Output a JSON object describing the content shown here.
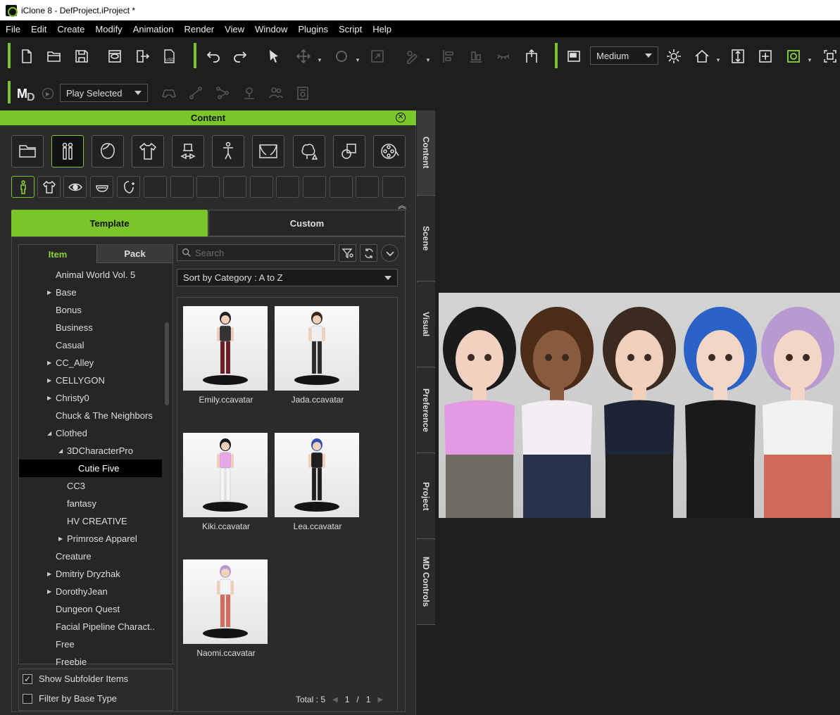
{
  "window": {
    "title": "iClone 8 - DefProject.iProject *"
  },
  "menu": [
    "File",
    "Edit",
    "Create",
    "Modify",
    "Animation",
    "Render",
    "View",
    "Window",
    "Plugins",
    "Script",
    "Help"
  ],
  "toolbar": {
    "quality": "Medium",
    "play_mode": "Play Selected"
  },
  "panel": {
    "title": "Content",
    "tabs": {
      "template": "Template",
      "custom": "Custom"
    },
    "tree_tabs": {
      "item": "Item",
      "pack": "Pack"
    },
    "search_placeholder": "Search",
    "sort": "Sort by Category : A to Z",
    "tree": [
      {
        "label": "Animal World Vol. 5",
        "level": 0,
        "arrow": ""
      },
      {
        "label": "Base",
        "level": 0,
        "arrow": "▶"
      },
      {
        "label": "Bonus",
        "level": 0,
        "arrow": ""
      },
      {
        "label": "Business",
        "level": 0,
        "arrow": ""
      },
      {
        "label": "Casual",
        "level": 0,
        "arrow": ""
      },
      {
        "label": "CC_Alley",
        "level": 0,
        "arrow": "▶"
      },
      {
        "label": "CELLYGON",
        "level": 0,
        "arrow": "▶"
      },
      {
        "label": "Christy0",
        "level": 0,
        "arrow": "▶"
      },
      {
        "label": "Chuck & The Neighbors",
        "level": 0,
        "arrow": ""
      },
      {
        "label": "Clothed",
        "level": 0,
        "arrow": "◢"
      },
      {
        "label": "3DCharacterPro",
        "level": 1,
        "arrow": "◢"
      },
      {
        "label": "Cutie Five",
        "level": 2,
        "arrow": "",
        "selected": true
      },
      {
        "label": "CC3",
        "level": 1,
        "arrow": ""
      },
      {
        "label": "fantasy",
        "level": 1,
        "arrow": ""
      },
      {
        "label": "HV CREATIVE",
        "level": 1,
        "arrow": ""
      },
      {
        "label": "Primrose Apparel",
        "level": 1,
        "arrow": "▶"
      },
      {
        "label": "Creature",
        "level": 0,
        "arrow": ""
      },
      {
        "label": "Dmitriy Dryzhak",
        "level": 0,
        "arrow": "▶"
      },
      {
        "label": "DorothyJean",
        "level": 0,
        "arrow": "▶"
      },
      {
        "label": "Dungeon Quest",
        "level": 0,
        "arrow": ""
      },
      {
        "label": "Facial Pipeline Charact..",
        "level": 0,
        "arrow": ""
      },
      {
        "label": "Free",
        "level": 0,
        "arrow": ""
      },
      {
        "label": "Freebie",
        "level": 0,
        "arrow": ""
      }
    ],
    "items": [
      {
        "label": "Emily.ccavatar",
        "top": "#333",
        "bottom": "#6b1e22",
        "hair": "#222"
      },
      {
        "label": "Jada.ccavatar",
        "top": "#f0f0f0",
        "bottom": "#2a2a2a",
        "hair": "#3a2616"
      },
      {
        "label": "Kiki.ccavatar",
        "top": "#e6a8e6",
        "bottom": "#f4f4f4",
        "hair": "#1a1a1a"
      },
      {
        "label": "Lea.ccavatar",
        "top": "#1e1e1e",
        "bottom": "#1e1e1e",
        "hair": "#3050b0"
      },
      {
        "label": "Naomi.ccavatar",
        "top": "#f4f4f4",
        "bottom": "#d36b5e",
        "hair": "#b89ad0"
      }
    ],
    "total_label": "Total : 5",
    "page": "1",
    "page_sep": "/",
    "page_count": "1",
    "options": {
      "show_subfolder": "Show Subfolder Items",
      "filter_base": "Filter by Base Type"
    }
  },
  "side_tabs": [
    "Content",
    "Scene",
    "Visual",
    "Preference",
    "Project",
    "MD Controls"
  ],
  "viewport": {
    "characters": [
      {
        "hair": "#1b1b1b",
        "top": "#e39ae3",
        "bottom": "#6e6a60",
        "skin": "#f1d2c0"
      },
      {
        "hair": "#4a2c18",
        "top": "#f3eef3",
        "bottom": "#25324a",
        "skin": "#8a5a3e"
      },
      {
        "hair": "#3a2a20",
        "top": "#1d2436",
        "bottom": "#1e1e1e",
        "skin": "#f0cfbd"
      },
      {
        "hair": "#2a62c8",
        "top": "#1a1a1a",
        "bottom": "#1a1a1a",
        "skin": "#f1d6c6"
      },
      {
        "hair": "#b89ad0",
        "top": "#f2f2f2",
        "bottom": "#d26a5c",
        "skin": "#f3d6c7"
      }
    ]
  }
}
